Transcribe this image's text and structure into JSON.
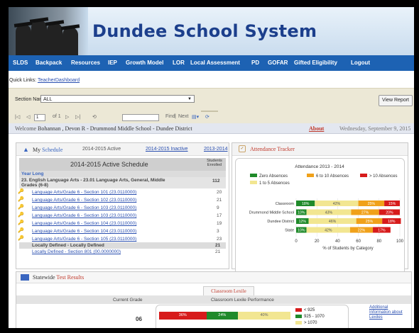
{
  "app": {
    "title": "Dundee School System"
  },
  "nav": [
    "SLDS",
    "Backpack",
    "Resources",
    "IEP",
    "Growth Model",
    "LOR",
    "Local Assessment",
    "PD",
    "GOFAR",
    "Gifted Eligibility",
    "Logout"
  ],
  "quick_links": {
    "label": "Quick Links:",
    "link": "TeacherDashboard"
  },
  "params": {
    "section_label": "Section Name",
    "section_value": "ALL",
    "view_report": "View Report"
  },
  "toolbar": {
    "page_value": "1",
    "page_of": "of 1",
    "find": "Find",
    "next": "Next",
    "sep": "|"
  },
  "welcome": {
    "text": "Welcome",
    "name": "Bohannan , Devon R - Drummond Middle School - Dundee District",
    "about": "About",
    "date": "Wednesday, September 9, 2015"
  },
  "schedule": {
    "my": "My",
    "schedule": "Schedule",
    "year_active": "2014-2015 Active",
    "tab_inactive": "2014-2015 Inactive",
    "tab_prev": "2013-2014",
    "table_title": "2014-2015 Active Schedule",
    "col_students": "Students Enrolled",
    "group_year": "Year Long",
    "course_name": "23. English Language Arts - 23.01 Language Arts, General, Middle Grades (6-8)",
    "course_count": "112",
    "sections": [
      {
        "name": "Language Arts/Grade 6 - Section 101 (23.0110000)",
        "count": "20"
      },
      {
        "name": "Language Arts/Grade 6 - Section 102 (23.0110000)",
        "count": "21"
      },
      {
        "name": "Language Arts/Grade 6 - Section 103 (23.0110000)",
        "count": "9"
      },
      {
        "name": "Language Arts/Grade 6 - Section 103 (23.0110000)",
        "count": "17"
      },
      {
        "name": "Language Arts/Grade 6 - Section 104 (23.0110000)",
        "count": "19"
      },
      {
        "name": "Language Arts/Grade 6 - Section 104 (23.0110000)",
        "count": "3"
      },
      {
        "name": "Language Arts/Grade 6 - Section 105 (23.0110000)",
        "count": "23"
      }
    ],
    "local_group": "Locally Defined - Locally Defined",
    "local_count": "21",
    "local_section": "Locally Defined - Section 801 (00.0000000)",
    "local_section_count": "21"
  },
  "attendance": {
    "panel_title": "Attendance Tracker",
    "chart_data": {
      "type": "bar",
      "orientation": "horizontal-stacked-percent",
      "title": "Attendance 2013 - 2014",
      "xlabel": "% of Students by Category",
      "xlim": [
        0,
        100
      ],
      "xticks": [
        "0",
        "20",
        "40",
        "60",
        "80",
        "100"
      ],
      "categories": [
        "Classroom",
        "Drummond Middle School",
        "Dundee District",
        "State"
      ],
      "series": [
        {
          "name": "Zero Absences",
          "color": "#1f8a2a",
          "values": [
            18,
            10,
            12,
            10
          ]
        },
        {
          "name": "1 to 5 Absences",
          "color": "#f2e691",
          "values": [
            42,
            43,
            46,
            42
          ]
        },
        {
          "name": "6 to 10 Absences",
          "color": "#f0a11a",
          "values": [
            25,
            27,
            25,
            22
          ]
        },
        {
          "name": "> 10 Absences",
          "color": "#d71b1b",
          "values": [
            15,
            20,
            18,
            17
          ]
        }
      ],
      "labels": [
        [
          "18%",
          "42%",
          "25%",
          "15%"
        ],
        [
          "10%",
          "43%",
          "27%",
          "20%"
        ],
        [
          "12%",
          "46%",
          "25%",
          "18%"
        ],
        [
          "10%",
          "42%",
          "22%",
          "17%"
        ]
      ]
    }
  },
  "statewide": {
    "title_a": "Statewide",
    "title_b": "Test Results",
    "tab": "Classroom Lexile",
    "col_grade": "Current Grade",
    "col_perf": "Classroom Lexile Performance",
    "grade": "06",
    "bar": [
      {
        "label": "36%",
        "value": 36,
        "color": "#d71b1b"
      },
      {
        "label": "24%",
        "value": 24,
        "color": "#1f8a2a"
      },
      {
        "label": "40%",
        "value": 40,
        "color": "#f2e691"
      }
    ],
    "legend": [
      {
        "label": "< 925",
        "color": "#d71b1b"
      },
      {
        "label": "925 - 1070",
        "color": "#1f8a2a"
      },
      {
        "label": "> 1070",
        "color": "#f2e691"
      }
    ],
    "additional_link": "Additional Information about Lexiles"
  }
}
